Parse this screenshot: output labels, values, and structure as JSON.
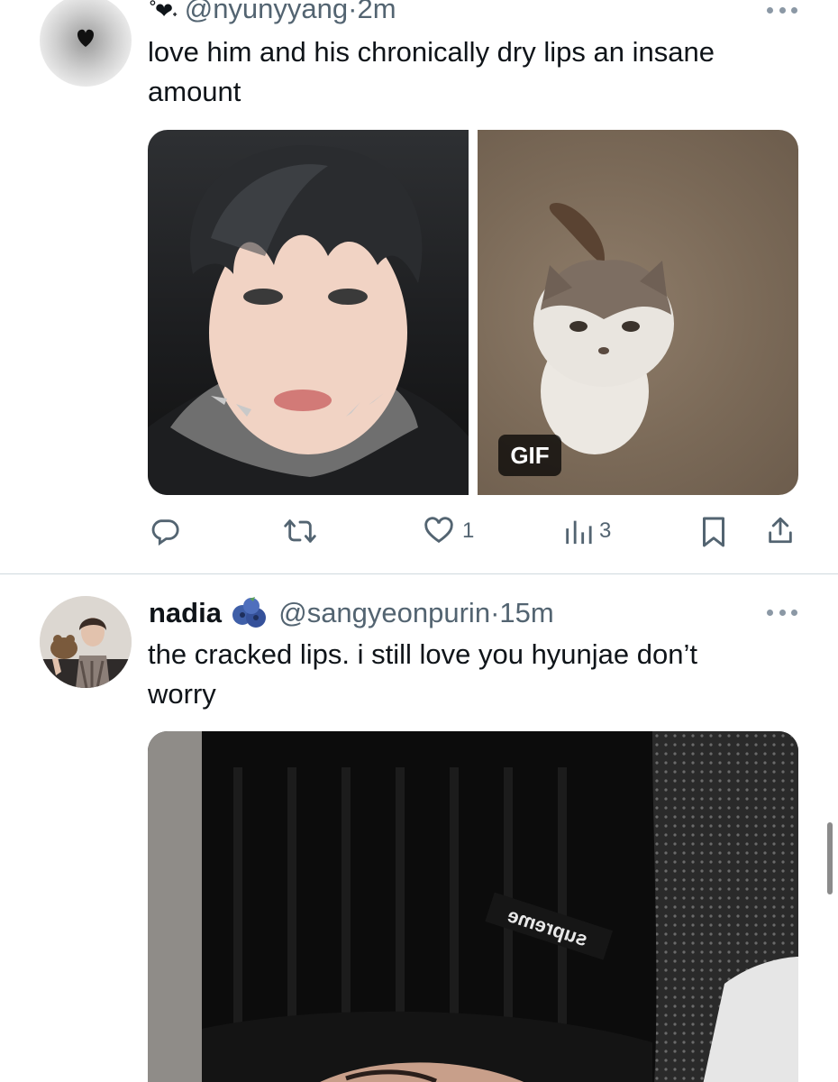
{
  "tweets": [
    {
      "display_name_decoration": "˚❤︎˖",
      "handle": "@nyunyyang",
      "separator": "·",
      "time": "2m",
      "text_line1": "love him and his chronically dry lips an insane",
      "text_line2": "amount",
      "media_badge": "GIF",
      "actions": {
        "reply": "",
        "retweet": "",
        "like": "1",
        "views": "3"
      }
    },
    {
      "display_name": "nadia",
      "name_emoji": "blueberries-emoji",
      "handle": "@sangyeonpurin",
      "separator": "·",
      "time": "15m",
      "text_line1": "the cracked lips. i still love you hyunjae don’t",
      "text_line2": "worry",
      "media_text": "supreme"
    }
  ],
  "icons": [
    "more-icon",
    "reply-icon",
    "retweet-icon",
    "like-icon",
    "views-icon",
    "bookmark-icon",
    "share-icon"
  ],
  "colors": {
    "text": "#0f1419",
    "secondary": "#536471",
    "divider": "#cfd9de"
  }
}
